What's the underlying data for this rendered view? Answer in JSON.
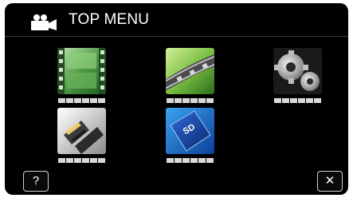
{
  "header": {
    "title": "TOP MENU",
    "icon": "video-camera-icon"
  },
  "menu": {
    "items": [
      {
        "name": "video-film",
        "icon": "film-strip-icon"
      },
      {
        "name": "editing",
        "icon": "film-reel-icon"
      },
      {
        "name": "settings",
        "icon": "gears-icon"
      },
      {
        "name": "connection",
        "icon": "hdmi-cable-icon"
      },
      {
        "name": "media",
        "icon": "sd-card-icon"
      }
    ]
  },
  "footer": {
    "help_label": "?",
    "close_label": "✕"
  },
  "colors": {
    "background": "#000000",
    "text": "#ffffff",
    "placeholder": "#d9d9d9"
  }
}
